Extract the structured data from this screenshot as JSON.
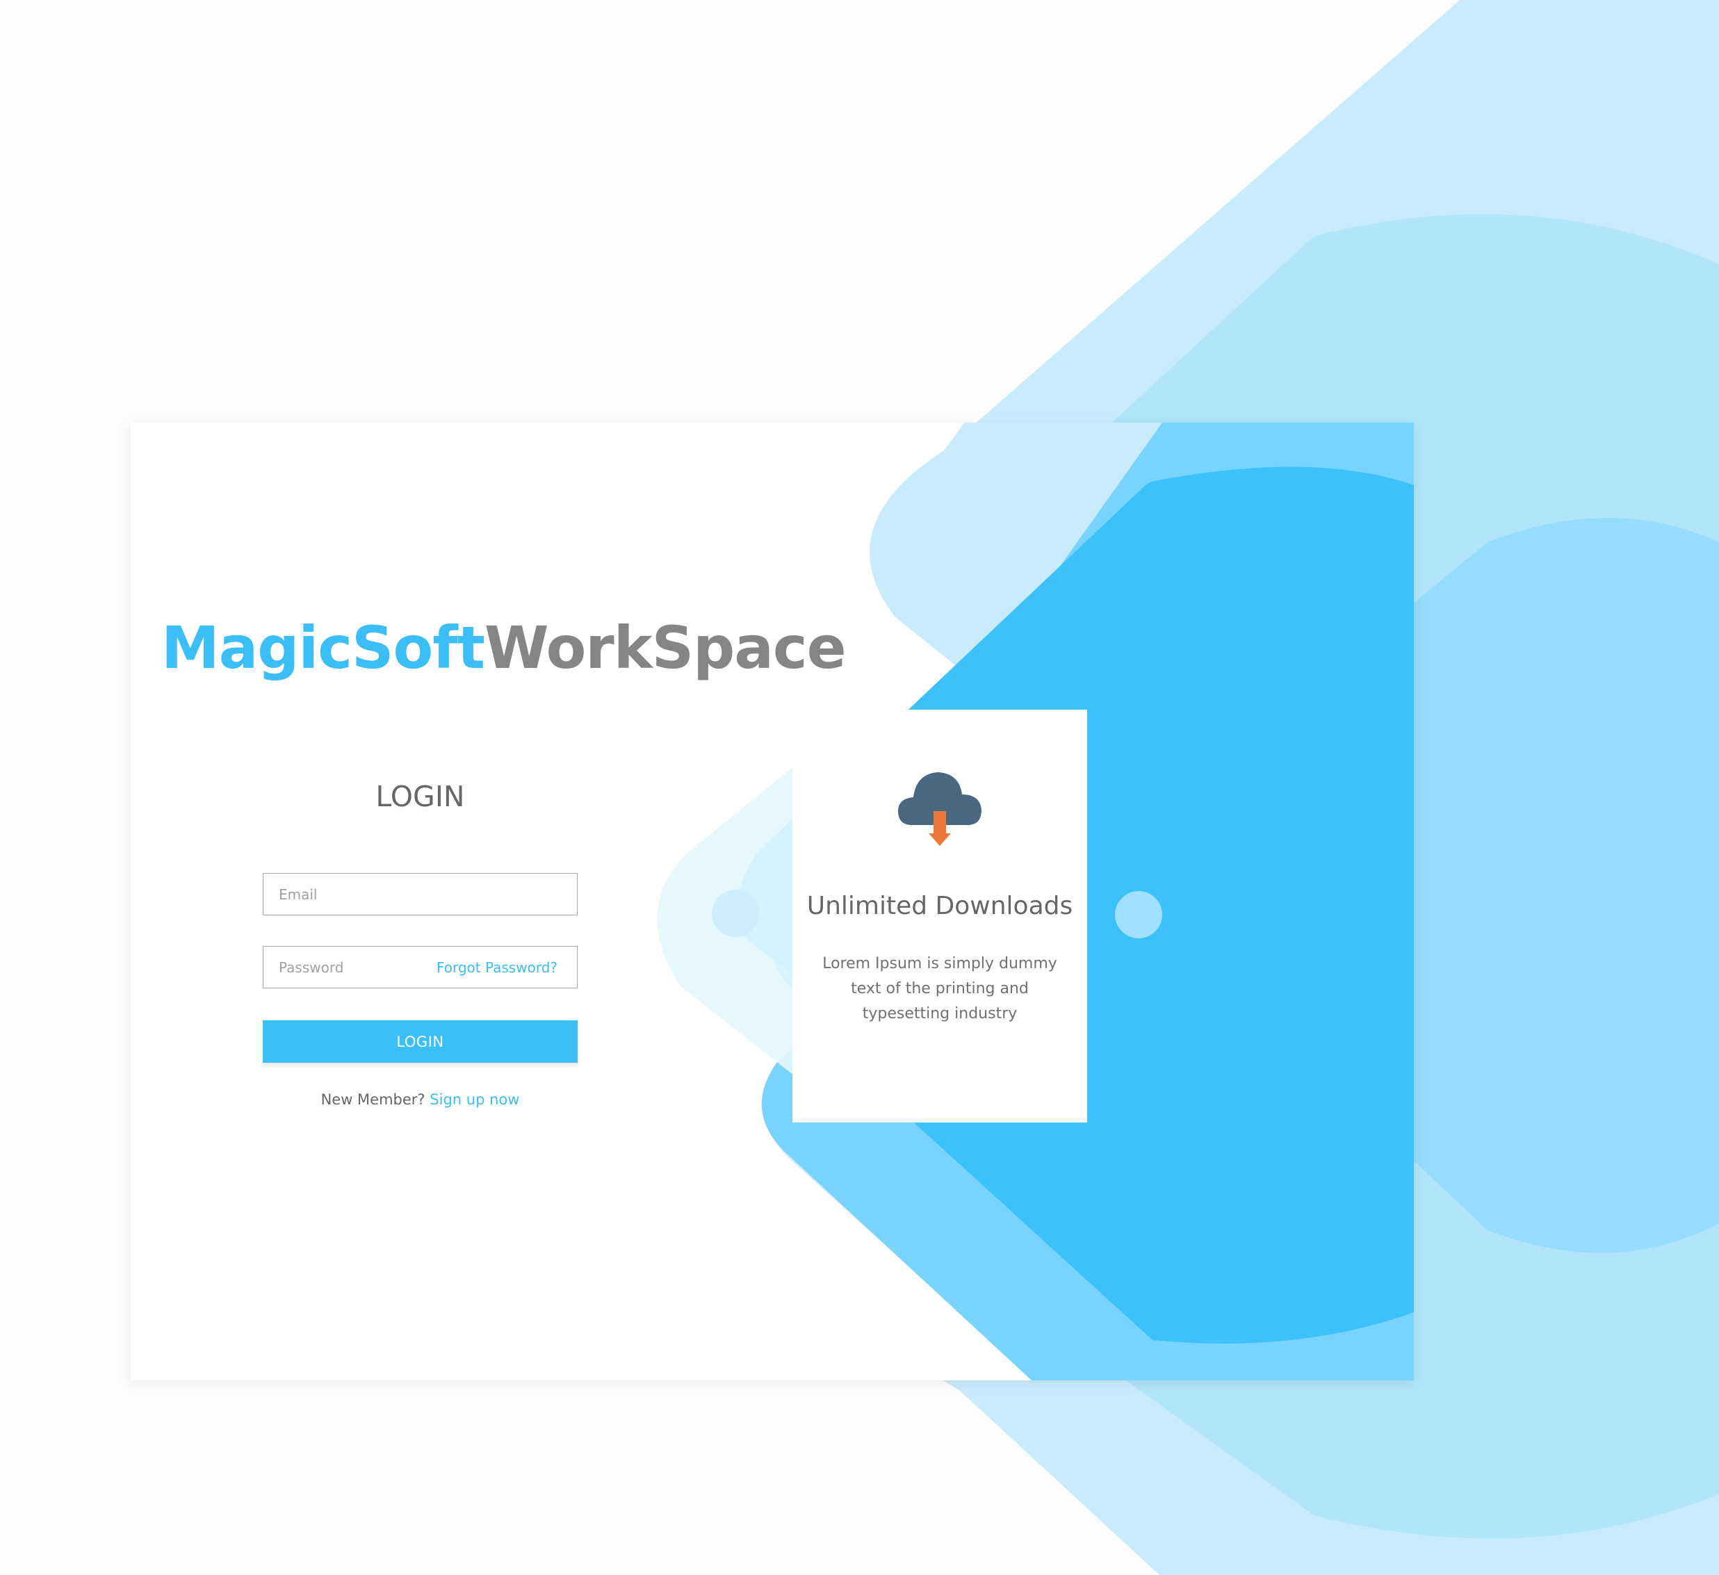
{
  "brand": {
    "part1": "MagicSoft",
    "part2": "WorkSpace"
  },
  "login": {
    "heading": "LOGIN",
    "email_placeholder": "Email",
    "password_placeholder": "Password",
    "forgot_label": "Forgot Password?",
    "button_label": "LOGIN",
    "new_member_text": "New Member?",
    "signup_label": "Sign up now"
  },
  "feature": {
    "icon": "cloud-download-icon",
    "title": "Unlimited Downloads",
    "description": "Lorem Ipsum is simply dummy text of the printing and typesetting industry"
  },
  "colors": {
    "accent": "#3bbff7",
    "brand_secondary": "#858585",
    "icon_cloud": "#4b6882",
    "icon_arrow": "#ee7838"
  }
}
